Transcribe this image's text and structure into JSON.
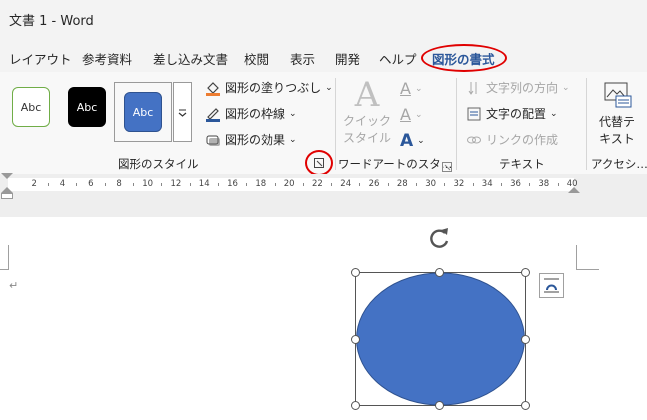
{
  "titlebar": {
    "title": "文書 1  -  Word"
  },
  "tabs": [
    {
      "label": "レイアウト"
    },
    {
      "label": "参考資料"
    },
    {
      "label": "差し込み文書"
    },
    {
      "label": "校閲"
    },
    {
      "label": "表示"
    },
    {
      "label": "開発"
    },
    {
      "label": "ヘルプ"
    },
    {
      "label": "図形の書式",
      "active": true
    }
  ],
  "shape_styles": {
    "swatches": [
      {
        "label": "Abc",
        "fill": "#ffffff",
        "border": "#70ad47",
        "text": "#333333"
      },
      {
        "label": "Abc",
        "fill": "#000000",
        "border": "#000000",
        "text": "#ffffff"
      },
      {
        "label": "Abc",
        "fill": "#4472c4",
        "border": "#2f528f",
        "text": "#ffffff"
      }
    ],
    "fill_label": "図形の塗りつぶし",
    "outline_label": "図形の枠線",
    "effects_label": "図形の効果",
    "group_label": "図形のスタイル"
  },
  "wordart": {
    "quick_style_line1": "クイック",
    "quick_style_line2": "スタイル",
    "group_label": "ワードアートのスタ…",
    "glyph": "A"
  },
  "text_group": {
    "direction_label": "文字列の方向",
    "align_label": "文字の配置",
    "link_label": "リンクの作成",
    "group_label": "テキスト"
  },
  "alt_text": {
    "line1": "代替テ",
    "line2": "キスト",
    "group_label": "アクセシ…"
  },
  "ruler": {
    "ticks": [
      "2",
      "4",
      "6",
      "8",
      "10",
      "12",
      "14",
      "16",
      "18",
      "20",
      "22",
      "24",
      "26",
      "28",
      "30",
      "32",
      "34",
      "36",
      "38",
      "40"
    ]
  },
  "document": {
    "paragraph_mark": "↵",
    "shape_fill": "#4472c4"
  },
  "colors": {
    "accent": "#2b579a",
    "highlight_ring": "#e00000"
  }
}
